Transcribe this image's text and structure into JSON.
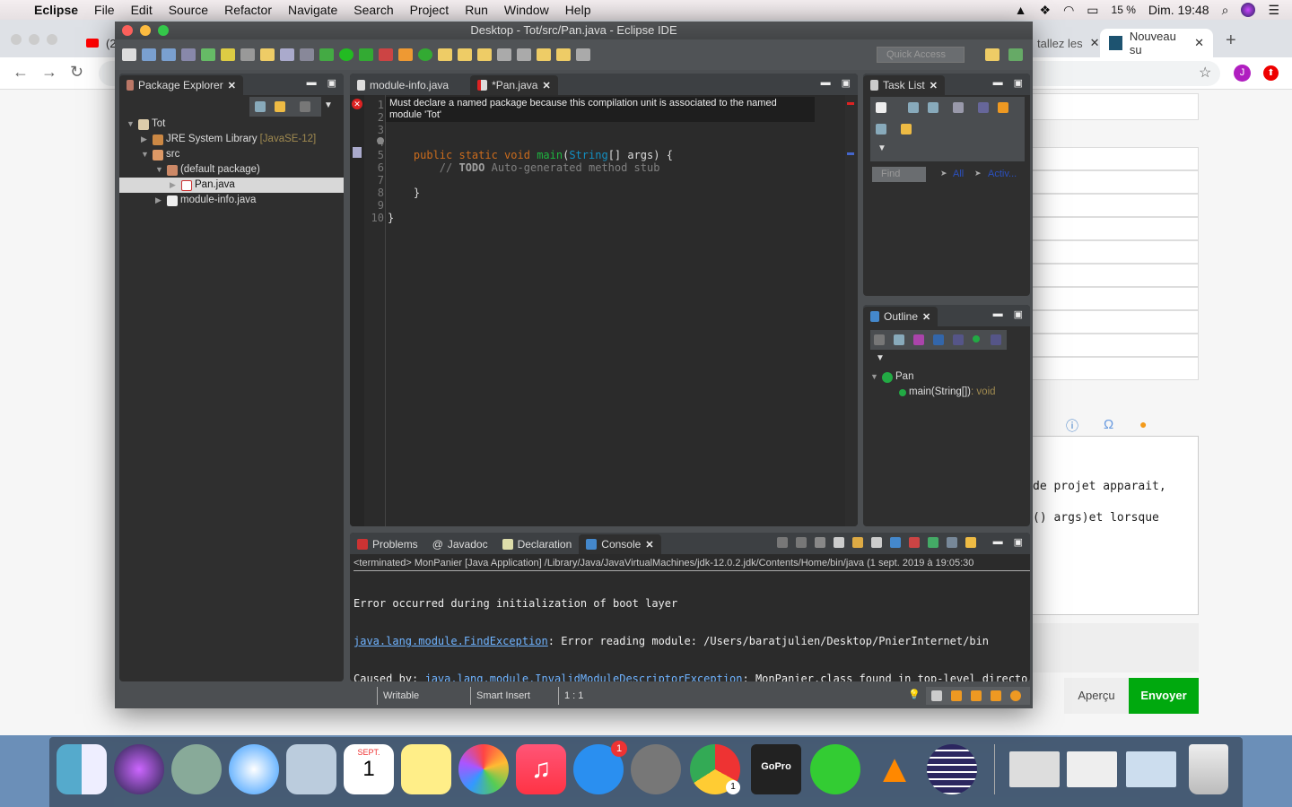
{
  "menubar": {
    "app": "Eclipse",
    "items": [
      "File",
      "Edit",
      "Source",
      "Refactor",
      "Navigate",
      "Search",
      "Project",
      "Run",
      "Window",
      "Help"
    ],
    "battery": "15 %",
    "clock": "Dim. 19:48"
  },
  "chrome": {
    "tabs": [
      {
        "label": "(2"
      },
      {
        "label": "tallez les"
      },
      {
        "label": "Nouveau su"
      }
    ],
    "avatar": "J",
    "form_text": [
      "de projet apparait,",
      "() args)et lorsque"
    ],
    "preview_button": "Aperçu",
    "send_button": "Envoyer",
    "send_color": "#00a90e"
  },
  "eclipse": {
    "title": "Desktop - Tot/src/Pan.java - Eclipse IDE",
    "quick_access": "Quick Access",
    "package_explorer": {
      "title": "Package Explorer",
      "tree": [
        {
          "label": "Tot"
        },
        {
          "label": "JRE System Library",
          "suffix": "[JavaSE-12]"
        },
        {
          "label": "src"
        },
        {
          "label": "(default package)"
        },
        {
          "label": "Pan.java"
        },
        {
          "label": "module-info.java"
        }
      ]
    },
    "editor": {
      "tabs": [
        {
          "label": "module-info.java"
        },
        {
          "label": "*Pan.java"
        }
      ],
      "tooltip": [
        "Must declare a named package because this compilation unit is associated to the named",
        "module 'Tot'"
      ],
      "line_numbers": [
        "1",
        "2",
        "3",
        "4",
        "5",
        "6",
        "7",
        "8",
        "9",
        "10"
      ],
      "code": {
        "l4_kw": "public static void ",
        "l4_fn": "main",
        "l4_ty": "String",
        "l4_rest": "[] args) {",
        "l4_open": "(",
        "l5_cm": "// ",
        "l5_todo": "TODO",
        "l5_rest": " Auto-generated method stub",
        "l7": "}",
        "l9": "}"
      }
    },
    "task_list": {
      "title": "Task List",
      "find_placeholder": "Find",
      "all": "All",
      "activate": "Activ..."
    },
    "outline": {
      "title": "Outline",
      "class": "Pan",
      "method": "main(String[])",
      "method_type": " : void"
    },
    "console": {
      "tabs": [
        "Problems",
        "Javadoc",
        "Declaration",
        "Console"
      ],
      "header": "<terminated> MonPanier [Java Application] /Library/Java/JavaVirtualMachines/jdk-12.0.2.jdk/Contents/Home/bin/java (1 sept. 2019 à 19:05:30",
      "lines": [
        {
          "text": "Error occurred during initialization of boot layer"
        },
        {
          "link": "java.lang.module.FindException",
          "text": ": Error reading module: /Users/baratjulien/Desktop/PnierInternet/bin"
        },
        {
          "prefix": "Caused by: ",
          "link": "java.lang.module.InvalidModuleDescriptorException",
          "text": ": MonPanier.class found in top-level directo"
        }
      ]
    },
    "status": {
      "writable": "Writable",
      "insert": "Smart Insert",
      "position": "1 : 1"
    }
  },
  "dock": {
    "calendar_month": "SEPT.",
    "calendar_day": "1",
    "appstore_badge": "1",
    "gopro": "GoPro",
    "chrome_badge": "1"
  }
}
